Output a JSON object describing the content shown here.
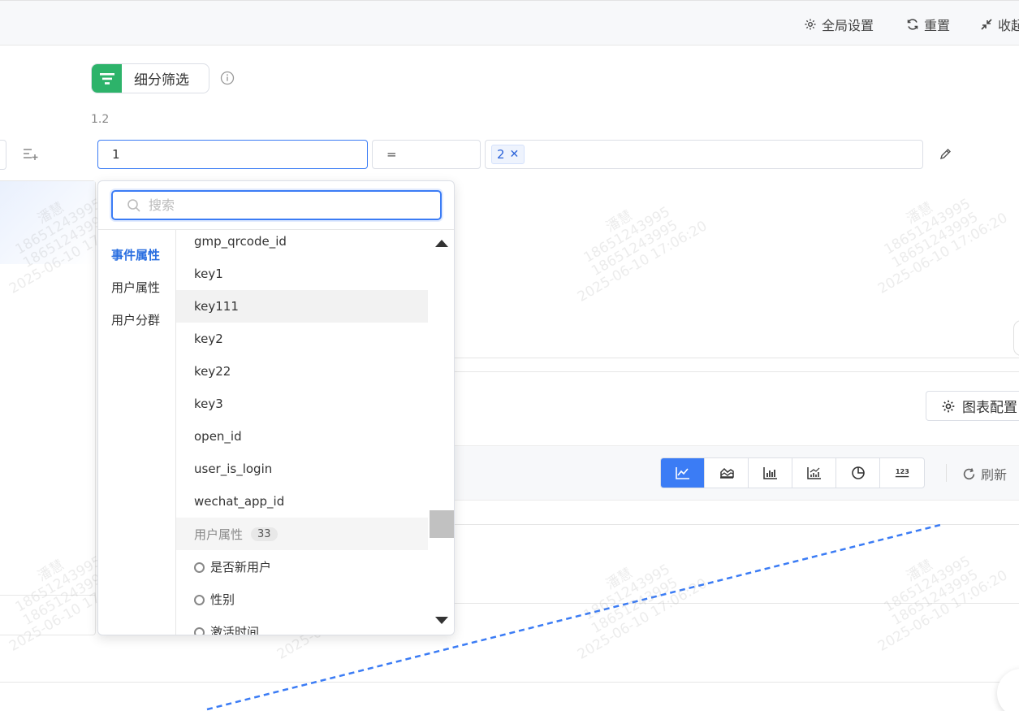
{
  "topbar": {
    "global_settings": "全局设置",
    "reset": "重置",
    "collapse": "收起"
  },
  "filter": {
    "chip_label": "细分筛选",
    "rule_index": "1.2",
    "property_value": "1",
    "operator": "=",
    "value_tags": [
      "2"
    ]
  },
  "dropdown": {
    "search_placeholder": "搜索",
    "categories": [
      {
        "label": "事件属性",
        "active": true
      },
      {
        "label": "用户属性",
        "active": false
      },
      {
        "label": "用户分群",
        "active": false
      }
    ],
    "items": [
      "gmp_qrcode_id",
      "key1",
      "key111",
      "key2",
      "key22",
      "key3",
      "open_id",
      "user_is_login",
      "wechat_app_id"
    ],
    "hovered_item": "key111",
    "group": {
      "label": "用户属性",
      "count": "33"
    },
    "user_items": [
      "是否新用户",
      "性别",
      "激活时间"
    ]
  },
  "chart_panel": {
    "config_label": "图表配置",
    "refresh_label": "刷新",
    "chart_types": [
      "line-chart-icon",
      "area-chart-icon",
      "bar-chart-icon",
      "combo-chart-icon",
      "pie-chart-icon",
      "number-icon"
    ],
    "active_chart_type": "line-chart-icon"
  },
  "watermark": {
    "name": "潘慧",
    "phone": "18651243995",
    "datetime": "2025-06-10 17:06:20"
  },
  "colors": {
    "accent": "#3b7cf5",
    "filter_icon_bg": "#2db36a",
    "trend_line": "#3b7cf5"
  }
}
